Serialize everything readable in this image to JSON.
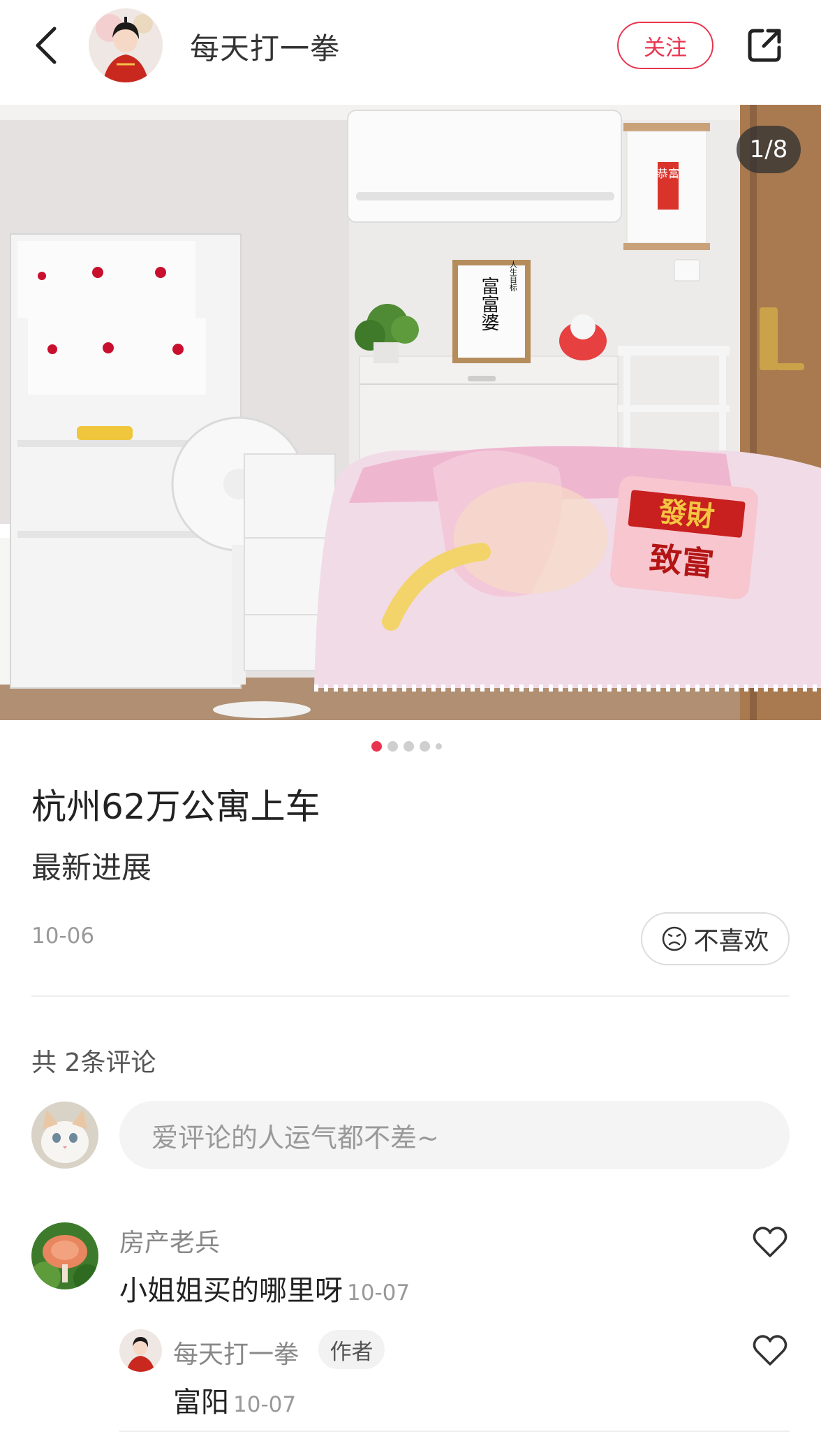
{
  "header": {
    "author_name": "每天打一拳",
    "follow_label": "关注"
  },
  "photo": {
    "counter": "1/8",
    "dots_total": 5,
    "active_dot": 1,
    "poster_text": "富富婆",
    "poster_side_text": "人生目标",
    "scroll_text": "恭富",
    "pillow_line1": "發財",
    "pillow_line2": "致富"
  },
  "post": {
    "title": "杭州62万公寓上车",
    "subtitle": "最新进展",
    "date": "10-06",
    "dislike_label": "不喜欢"
  },
  "comments": {
    "count_label": "共 2条评论",
    "input_placeholder": "爱评论的人运气都不差~",
    "items": [
      {
        "user": "房产老兵",
        "text": "小姐姐买的哪里呀",
        "date": "10-07"
      }
    ],
    "replies": [
      {
        "user": "每天打一拳",
        "badge": "作者",
        "text": "富阳",
        "date": "10-07"
      }
    ]
  },
  "colors": {
    "accent": "#e8354f",
    "muted": "#999999"
  }
}
